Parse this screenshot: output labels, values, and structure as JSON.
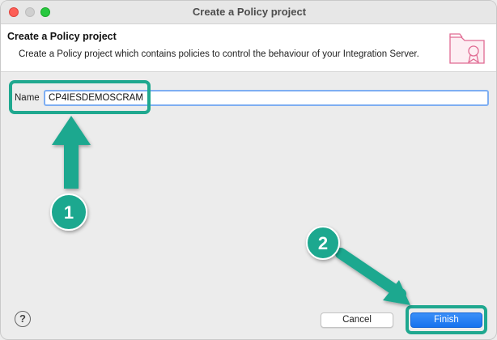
{
  "window": {
    "title": "Create a Policy project"
  },
  "header": {
    "title": "Create a Policy project",
    "description": "Create a Policy project which contains policies to control the behaviour of your Integration Server.",
    "icon": "policy-folder-icon"
  },
  "form": {
    "name_label": "Name",
    "name_value": "CP4IESDEMOSCRAM"
  },
  "footer": {
    "help_symbol": "?",
    "cancel_label": "Cancel",
    "finish_label": "Finish"
  },
  "annotations": {
    "step1": "1",
    "step2": "2",
    "accent_color": "#1fa88f"
  }
}
